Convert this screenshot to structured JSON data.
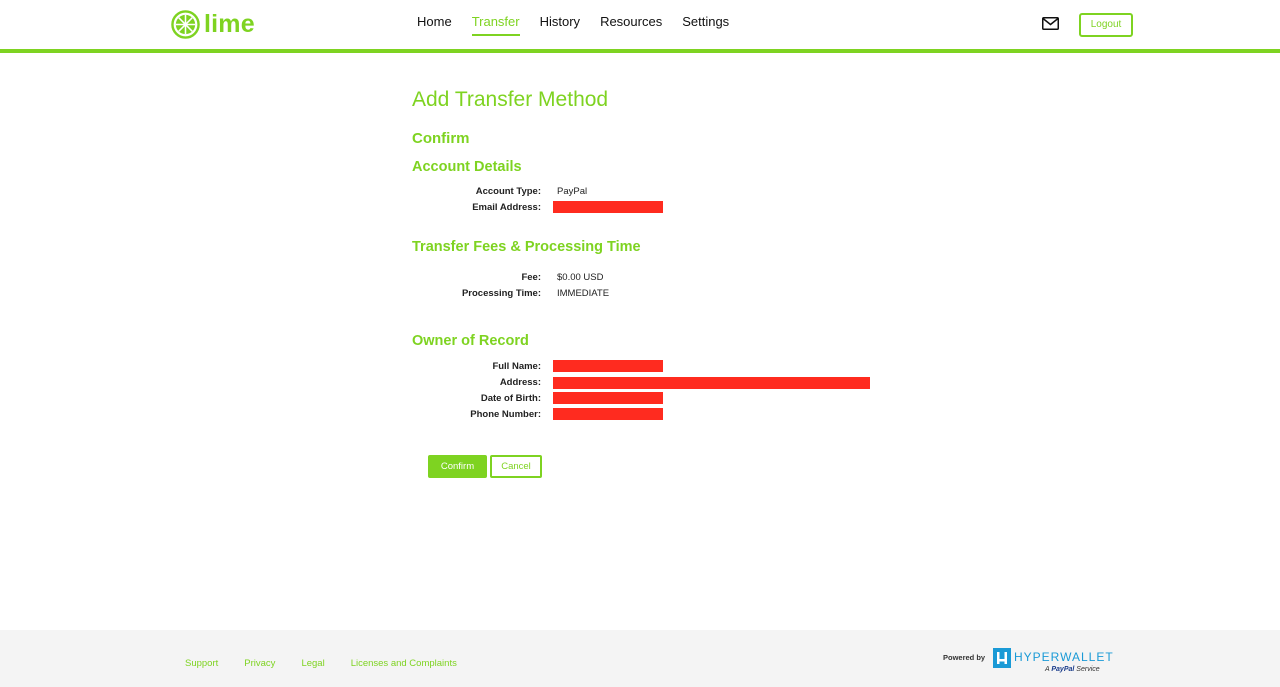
{
  "brand": {
    "name": "lime",
    "accent": "#7ed321",
    "redaction_color": "#ff2b1f"
  },
  "nav": {
    "items": [
      {
        "label": "Home",
        "active": false
      },
      {
        "label": "Transfer",
        "active": true
      },
      {
        "label": "History",
        "active": false
      },
      {
        "label": "Resources",
        "active": false
      },
      {
        "label": "Settings",
        "active": false
      }
    ],
    "mail_icon": "envelope-icon",
    "logout_label": "Logout"
  },
  "page": {
    "title": "Add Transfer Method",
    "step": "Confirm"
  },
  "account_details": {
    "heading": "Account Details",
    "rows": [
      {
        "label": "Account Type:",
        "value": "PayPal"
      },
      {
        "label": "Email Address:",
        "value": "",
        "redacted": true
      }
    ]
  },
  "fees": {
    "heading": "Transfer Fees & Processing Time",
    "rows": [
      {
        "label": "Fee:",
        "value": "$0.00 USD"
      },
      {
        "label": "Processing Time:",
        "value": "IMMEDIATE"
      }
    ]
  },
  "owner": {
    "heading": "Owner of Record",
    "rows": [
      {
        "label": "Full Name:",
        "value": "",
        "redacted": true
      },
      {
        "label": "Address:",
        "value": "",
        "redacted": true
      },
      {
        "label": "Date of Birth:",
        "value": "",
        "redacted": true
      },
      {
        "label": "Phone Number:",
        "value": "",
        "redacted": true
      }
    ]
  },
  "actions": {
    "confirm_label": "Confirm",
    "cancel_label": "Cancel"
  },
  "footer": {
    "links": [
      "Support",
      "Privacy",
      "Legal",
      "Licenses and Complaints"
    ],
    "powered_by": "Powered by",
    "provider": "HYPERWALLET",
    "provider_sub_prefix": "A",
    "provider_sub_brand": "PayPal",
    "provider_sub_suffix": "Service"
  }
}
